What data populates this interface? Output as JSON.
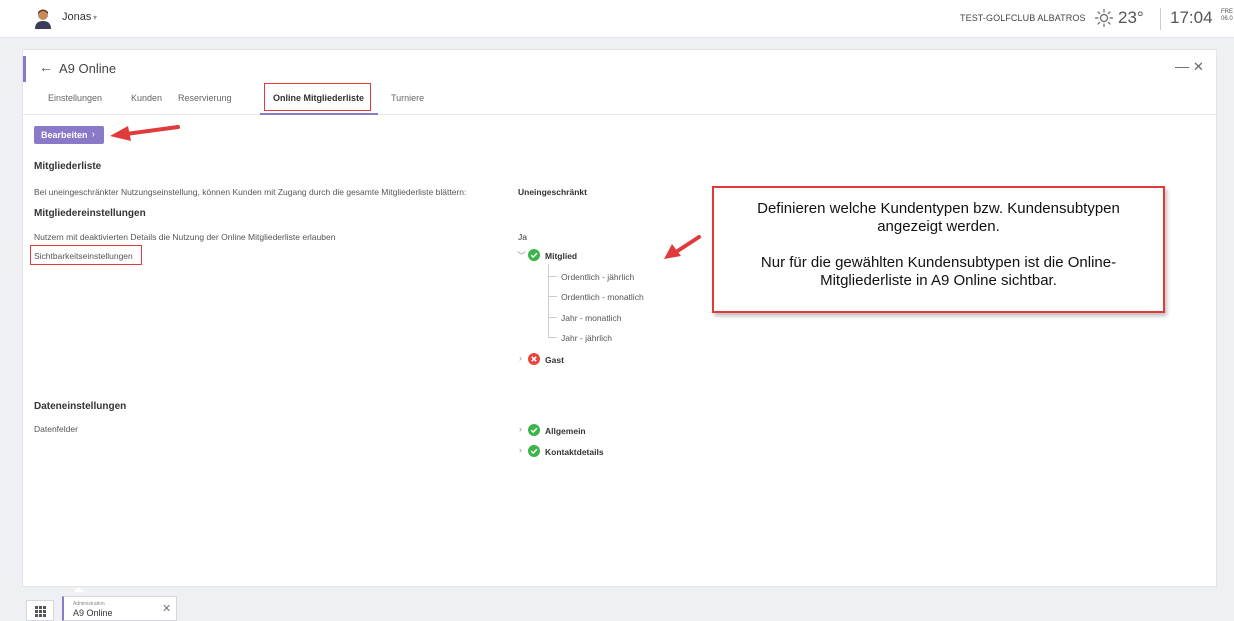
{
  "topbar": {
    "user_name": "Jonas",
    "user_caret": "▾",
    "club": "TEST-GOLFCLUB ALBATROS",
    "temperature": "23°",
    "time": "17:04",
    "date_line1": "FRE",
    "date_line2": "06.0"
  },
  "window": {
    "back": "←",
    "title": "A9 Online",
    "minimize": "—",
    "close": "✕"
  },
  "tabs": [
    {
      "label": "Einstellungen"
    },
    {
      "label": "Kunden"
    },
    {
      "label": "Reservierung"
    },
    {
      "label": "Online Mitgliederliste",
      "active": true
    },
    {
      "label": "Turniere"
    }
  ],
  "edit_button": {
    "label": "Bearbeiten",
    "chevron": "›"
  },
  "sections": {
    "mitgliederliste": {
      "heading": "Mitgliederliste",
      "row_label": "Bei uneingeschränkter Nutzungseinstellung, können Kunden mit Zugang durch die gesamte Mitgliederliste blättern:",
      "row_value": "Uneingeschränkt"
    },
    "mitgliedereinstellungen": {
      "heading": "Mitgliedereinstellungen",
      "row1_label": "Nutzern mit deaktivierten Details die Nutzung der Online Mitgliederliste erlauben",
      "row1_value": "Ja",
      "row2_label": "Sichtbarkeitseinstellungen"
    },
    "dateneinstellungen": {
      "heading": "Dateneinstellungen",
      "row_label": "Datenfelder"
    }
  },
  "visibility_tree": {
    "mitglied": {
      "label": "Mitglied",
      "status": "enabled",
      "children": [
        "Ordentlich - jährlich",
        "Ordentlich - monatlich",
        "Jahr - monatlich",
        "Jahr - jährlich"
      ]
    },
    "gast": {
      "label": "Gast",
      "status": "disabled"
    }
  },
  "data_fields": [
    {
      "label": "Allgemein",
      "status": "enabled"
    },
    {
      "label": "Kontaktdetails",
      "status": "enabled"
    }
  ],
  "callout": {
    "line1": "Definieren welche Kundentypen bzw. Kundensubtypen",
    "line2": "angezeigt werden.",
    "line3": "Nur für die gewählten Kundensubtypen ist die Online-",
    "line4": "Mitgliederliste in A9 Online sichtbar."
  },
  "taskbar": {
    "tab_sub": "Administration",
    "tab_name": "A9 Online",
    "tab_close": "✕"
  },
  "colors": {
    "accent": "#8a78c9",
    "enabled": "#3bb54a",
    "disabled": "#e8453c",
    "annotation": "#e03a3a"
  }
}
